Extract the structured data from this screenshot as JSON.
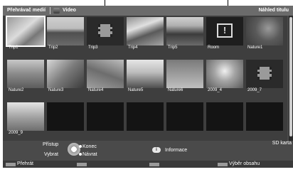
{
  "header": {
    "app_title": "Přehrávač medií",
    "category": "Video",
    "right_title": "Náhled titulu"
  },
  "tiles": [
    {
      "label": "Trip1"
    },
    {
      "label": "Trip2"
    },
    {
      "label": "Trip3"
    },
    {
      "label": "Trip4"
    },
    {
      "label": "Trip5"
    },
    {
      "label": "Room"
    },
    {
      "label": "Nature1"
    },
    {
      "label": "Nature2"
    },
    {
      "label": "Nature3"
    },
    {
      "label": "Nature4"
    },
    {
      "label": "Nature5"
    },
    {
      "label": "Nature6"
    },
    {
      "label": "2009_4"
    },
    {
      "label": "2009_7"
    },
    {
      "label": "2009_9"
    }
  ],
  "footer": {
    "access": "Přístup",
    "select": "Vybrat",
    "exit": "Konec",
    "back": "Návrat",
    "info_key": "i",
    "info": "Informace",
    "sd_card": "SD karta"
  },
  "colorbar": {
    "play": "Přehrát",
    "select_content": "Výběr obsahu"
  },
  "icons": {
    "film": "film-icon",
    "room": "room-exclamation-icon"
  }
}
